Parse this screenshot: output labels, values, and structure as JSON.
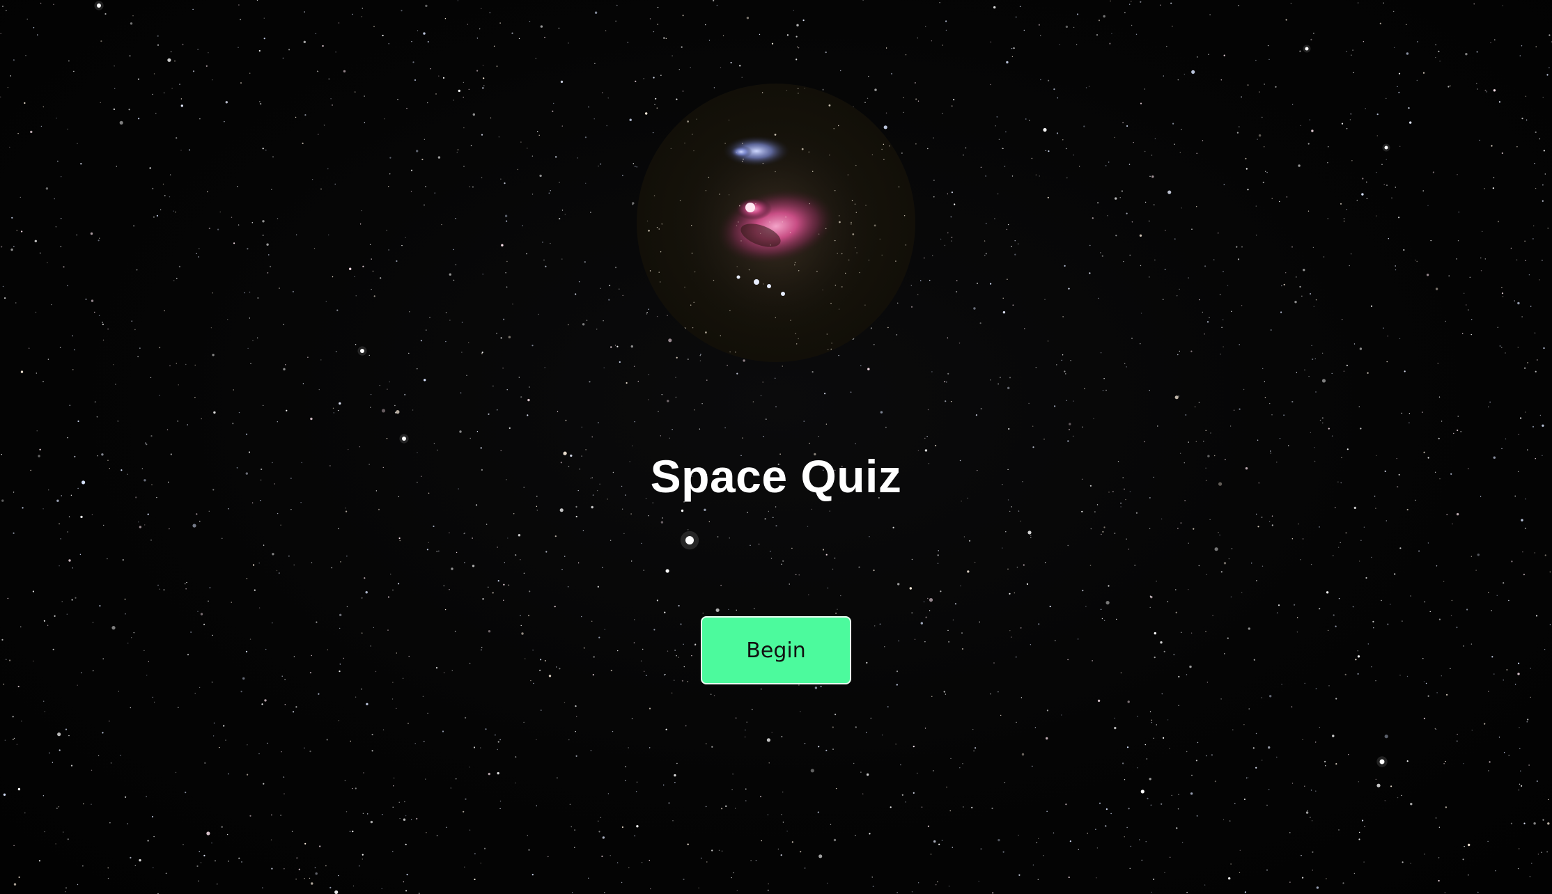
{
  "page": {
    "title": "Space Quiz",
    "background": "starfield",
    "hero_image": "orion-nebula"
  },
  "actions": {
    "begin_label": "Begin"
  },
  "colors": {
    "background": "#030303",
    "title_text": "#ffffff",
    "button_bg": "#4cfa9d",
    "button_text": "#111111",
    "nebula_pink": "#d0508a"
  }
}
